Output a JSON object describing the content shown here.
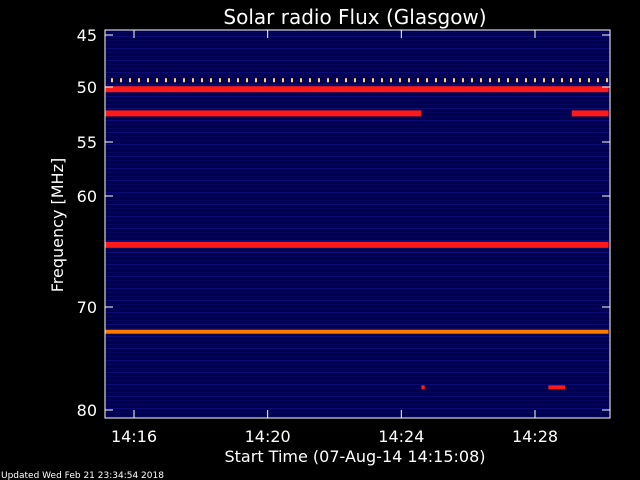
{
  "chart_data": {
    "type": "heatmap",
    "title": "Solar radio Flux (Glasgow)",
    "ylabel": "Frequency [MHz]",
    "xlabel": "Start Time (07-Aug-14 14:15:08)",
    "footer": "Updated Wed Feb 21 23:34:54 2018",
    "x_ticks": [
      "14:16",
      "14:20",
      "14:24",
      "14:28"
    ],
    "x_tick_minutes": [
      16,
      20,
      24,
      28
    ],
    "y_ticks": [
      45,
      50,
      55,
      60,
      70,
      80
    ],
    "xlim_minutes": [
      15.13,
      30.2
    ],
    "ylim_mhz": [
      45,
      80
    ],
    "colors": {
      "background": "#02024a",
      "emission_strong": "#ff1a1a",
      "emission_medium": "#ff7a00",
      "emission_weak": "#ffd070",
      "text": "#ffffff"
    },
    "bands": [
      {
        "freq_mhz": 50.2,
        "start_min": 15.13,
        "end_min": 30.2,
        "intensity": "strong",
        "pattern": "continuous"
      },
      {
        "freq_mhz": 49.3,
        "start_min": 15.13,
        "end_min": 30.2,
        "intensity": "weak",
        "pattern": "intermittent"
      },
      {
        "freq_mhz": 52.4,
        "start_min": 15.13,
        "end_min": 24.6,
        "intensity": "strong",
        "pattern": "continuous"
      },
      {
        "freq_mhz": 52.4,
        "start_min": 29.1,
        "end_min": 30.2,
        "intensity": "strong",
        "pattern": "continuous"
      },
      {
        "freq_mhz": 64.4,
        "start_min": 15.13,
        "end_min": 30.2,
        "intensity": "strong",
        "pattern": "continuous"
      },
      {
        "freq_mhz": 72.4,
        "start_min": 15.13,
        "end_min": 30.2,
        "intensity": "medium",
        "pattern": "continuous"
      },
      {
        "freq_mhz": 77.8,
        "start_min": 24.6,
        "end_min": 24.7,
        "intensity": "strong",
        "pattern": "spot"
      },
      {
        "freq_mhz": 77.8,
        "start_min": 28.4,
        "end_min": 28.9,
        "intensity": "strong",
        "pattern": "spot"
      }
    ]
  }
}
